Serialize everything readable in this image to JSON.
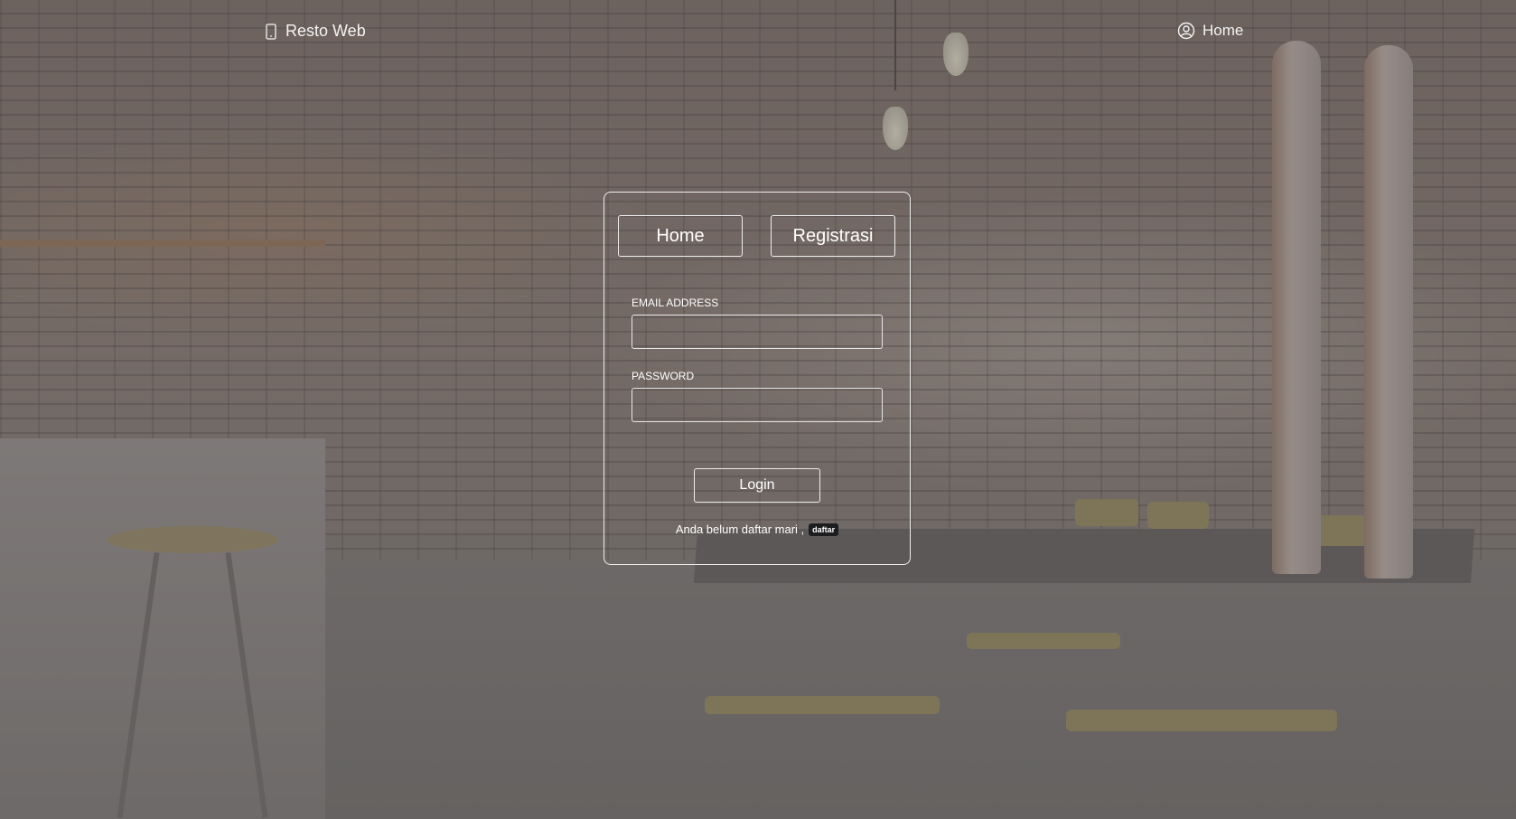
{
  "header": {
    "brand_label": "Resto Web",
    "brand_icon": "phone-icon",
    "nav_home_label": "Home",
    "nav_home_icon": "user-circle-icon"
  },
  "login_card": {
    "tabs": [
      {
        "label": "Home"
      },
      {
        "label": "Registrasi"
      }
    ],
    "email_label": "EMAIL ADDRESS",
    "email_value": "",
    "password_label": "PASSWORD",
    "password_value": "",
    "login_button_label": "Login",
    "register_prompt": "Anda belum daftar mari ,",
    "register_link_label": "daftar"
  },
  "colors": {
    "overlay": "#6e6e6e",
    "card_border": "#eeeeee",
    "badge_bg": "#1d1d1f",
    "text": "#ffffff"
  }
}
